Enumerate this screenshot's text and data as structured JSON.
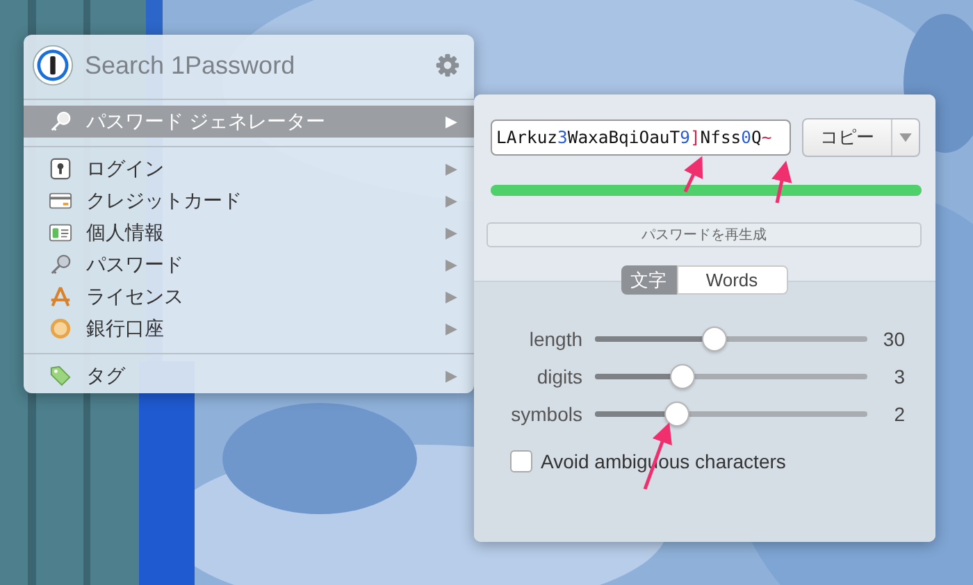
{
  "search": {
    "placeholder": "Search 1Password"
  },
  "menu_sections": [
    [
      {
        "kind": "key",
        "label": "パスワード ジェネレーター",
        "arrow": "▶",
        "selected": true
      }
    ],
    [
      {
        "kind": "login",
        "label": "ログイン",
        "arrow": "▶",
        "selected": false
      },
      {
        "kind": "card",
        "label": "クレジットカード",
        "arrow": "▶",
        "selected": false
      },
      {
        "kind": "id",
        "label": "個人情報",
        "arrow": "▶",
        "selected": false
      },
      {
        "kind": "key",
        "label": "パスワード",
        "arrow": "▶",
        "selected": false
      },
      {
        "kind": "license",
        "label": "ライセンス",
        "arrow": "▶",
        "selected": false
      },
      {
        "kind": "bank",
        "label": "銀行口座",
        "arrow": "▶",
        "selected": false
      }
    ],
    [
      {
        "kind": "tag",
        "label": "タグ",
        "arrow": "▶",
        "selected": false
      }
    ]
  ],
  "generator": {
    "password": [
      {
        "kind": "letter",
        "text": "LArkuz"
      },
      {
        "kind": "digit",
        "text": "3"
      },
      {
        "kind": "letter",
        "text": "WaxaBqiOauT"
      },
      {
        "kind": "digit",
        "text": "9"
      },
      {
        "kind": "symbol",
        "text": "]"
      },
      {
        "kind": "letter",
        "text": "Nfss"
      },
      {
        "kind": "digit",
        "text": "0"
      },
      {
        "kind": "letter",
        "text": "Q"
      },
      {
        "kind": "symbol",
        "text": "~"
      }
    ],
    "copy_button": "コピー",
    "strength": {
      "level": 1.0
    },
    "regenerate_button": "パスワードを再生成",
    "modes": [
      {
        "label": "文字",
        "selected": true
      },
      {
        "label": "Words",
        "selected": false
      }
    ],
    "sliders": [
      {
        "name": "length",
        "level": 0.44,
        "reading": "30"
      },
      {
        "name": "digits",
        "level": 0.32,
        "reading": "3"
      },
      {
        "name": "symbols",
        "level": 0.3,
        "reading": "2"
      }
    ],
    "avoid_ambiguous": {
      "label": "Avoid ambiguous characters",
      "checked": false
    }
  }
}
